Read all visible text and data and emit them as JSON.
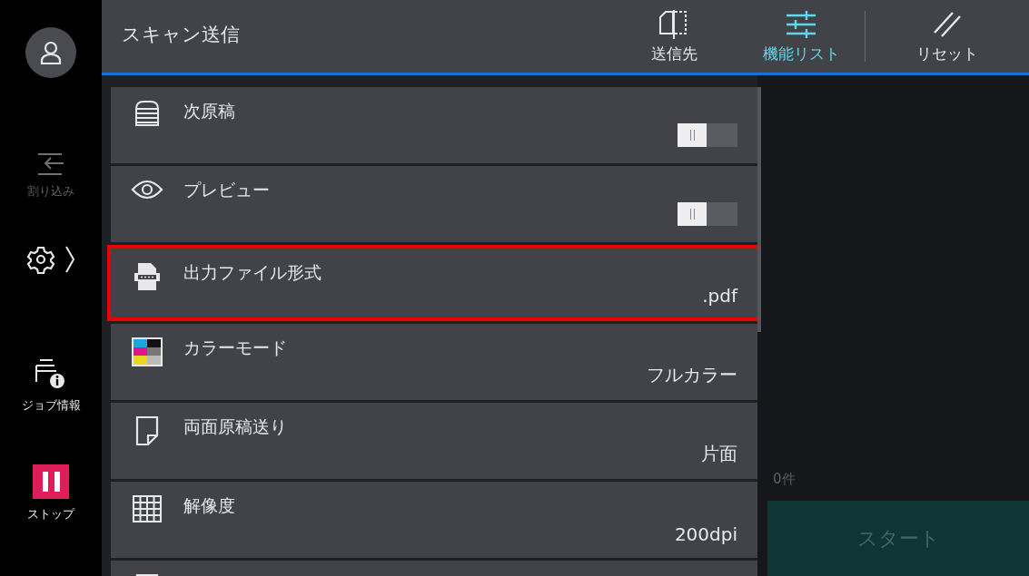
{
  "sidebar": {
    "items": [
      {
        "kind": "user"
      },
      {
        "kind": "interrupt",
        "label": "割り込み",
        "disabled": true
      },
      {
        "kind": "settings"
      },
      {
        "kind": "jobinfo",
        "label": "ジョブ情報",
        "disabled": false
      },
      {
        "kind": "stop",
        "label": "ストップ",
        "disabled": false
      }
    ]
  },
  "header": {
    "title": "スキャン送信",
    "tabs": [
      {
        "kind": "destination",
        "label": "送信先",
        "selected": false
      },
      {
        "kind": "features",
        "label": "機能リスト",
        "selected": true
      },
      {
        "kind": "reset",
        "label": "リセット",
        "selected": false
      }
    ]
  },
  "features": [
    {
      "label": "次原稿",
      "kind": "toggle",
      "on": false,
      "highlighted": false
    },
    {
      "label": "プレビュー",
      "kind": "toggle",
      "on": false,
      "highlighted": false
    },
    {
      "label": "出力ファイル形式",
      "kind": "value",
      "value": ".pdf",
      "highlighted": true
    },
    {
      "label": "カラーモード",
      "kind": "value",
      "value": "フルカラー",
      "highlighted": false
    },
    {
      "label": "両面原稿送り",
      "kind": "value",
      "value": "片面",
      "highlighted": false
    },
    {
      "label": "解像度",
      "kind": "value",
      "value": "200dpi",
      "highlighted": false
    },
    {
      "kind": "partial",
      "highlighted": false
    }
  ],
  "job_panel": {
    "count": "0件",
    "start_button": "スタート"
  }
}
